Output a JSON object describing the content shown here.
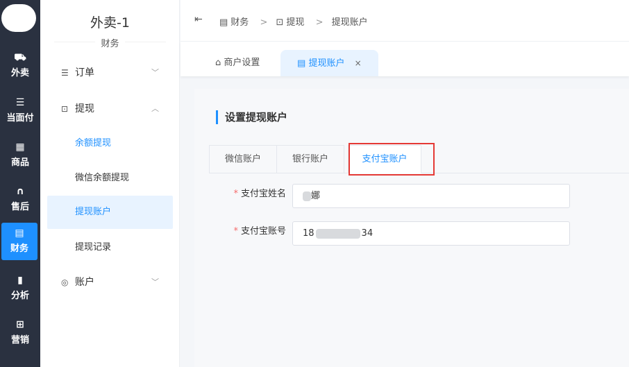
{
  "rail": {
    "items": [
      {
        "icon": "⛟",
        "label": "外卖"
      },
      {
        "icon": "☰",
        "label": "当面付"
      },
      {
        "icon": "▦",
        "label": "商品"
      },
      {
        "icon": "∩",
        "label": "售后"
      },
      {
        "icon": "▤",
        "label": "财务"
      },
      {
        "icon": "▮",
        "label": "分析"
      },
      {
        "icon": "⊞",
        "label": "营销"
      }
    ],
    "active_index": 4
  },
  "submenu": {
    "store_title": "外卖-1",
    "store_subtitle": "财务",
    "items": {
      "orders": {
        "label": "订单",
        "chevron": "﹀"
      },
      "withdraw": {
        "label": "提现",
        "chevron": "︿"
      },
      "balance_withdraw": "余额提现",
      "wechat_balance_withdraw": "微信余额提现",
      "withdraw_account": "提现账户",
      "withdraw_records": "提现记录",
      "account": {
        "label": "账户",
        "chevron": "﹀"
      }
    }
  },
  "breadcrumb": {
    "collapse_icon": "⇤",
    "items": [
      "财务",
      "提现",
      "提现账户"
    ],
    "separator": ">"
  },
  "page_tabs": [
    {
      "label": "商户设置",
      "icon": "store-icon"
    },
    {
      "label": "提现账户",
      "icon": "wallet-icon",
      "close": "×"
    }
  ],
  "card": {
    "title": "设置提现账户",
    "tabs": [
      "微信账户",
      "银行账户",
      "支付宝账户"
    ],
    "active_tab": 2,
    "fields": [
      {
        "label": "支付宝姓名",
        "required": "*",
        "value_visible": "娜"
      },
      {
        "label": "支付宝账号",
        "required": "*",
        "value_prefix": "18",
        "value_suffix": "34"
      }
    ]
  },
  "colors": {
    "accent": "#1e90ff",
    "rail_bg": "#2a3140",
    "highlight": "#e53935"
  }
}
